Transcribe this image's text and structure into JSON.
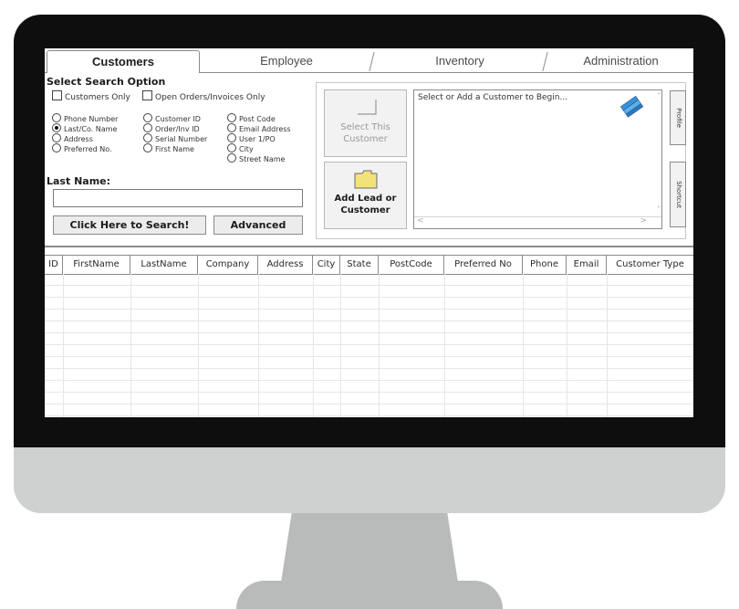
{
  "tabs": [
    "Customers",
    "Employee",
    "Inventory",
    "Administration"
  ],
  "search": {
    "title": "Select Search Option",
    "checkboxes": [
      "Customers Only",
      "Open Orders/Invoices Only"
    ],
    "radios": {
      "col1": [
        "Phone Number",
        "Last/Co. Name",
        "Address",
        "Preferred No."
      ],
      "col2": [
        "Customer ID",
        "Order/Inv ID",
        "Serial Number",
        "First Name"
      ],
      "col3": [
        "Post Code",
        "Email Address",
        "User 1/PO",
        "City",
        "Street Name"
      ]
    },
    "selected_radio": "Last/Co. Name",
    "field_label": "Last Name:",
    "field_value": "",
    "search_button": "Click Here to Search!",
    "advanced_button": "Advanced"
  },
  "actions": {
    "select_line1": "Select This",
    "select_line2": "Customer",
    "add_line1": "Add Lead or",
    "add_line2": "Customer"
  },
  "message": "Select or Add a Customer to Begin...",
  "side_tabs": [
    "Profile",
    "Shortcut"
  ],
  "grid": {
    "columns": [
      "ID",
      "FirstName",
      "LastName",
      "Company",
      "Address",
      "City",
      "State",
      "PostCode",
      "Preferred No",
      "Phone",
      "Email",
      "Customer Type"
    ]
  },
  "colors": {
    "bezel": "#0e0e0e",
    "chin": "#cfd0d0",
    "stand": "#b9baba",
    "folder": "#f2e27a"
  }
}
